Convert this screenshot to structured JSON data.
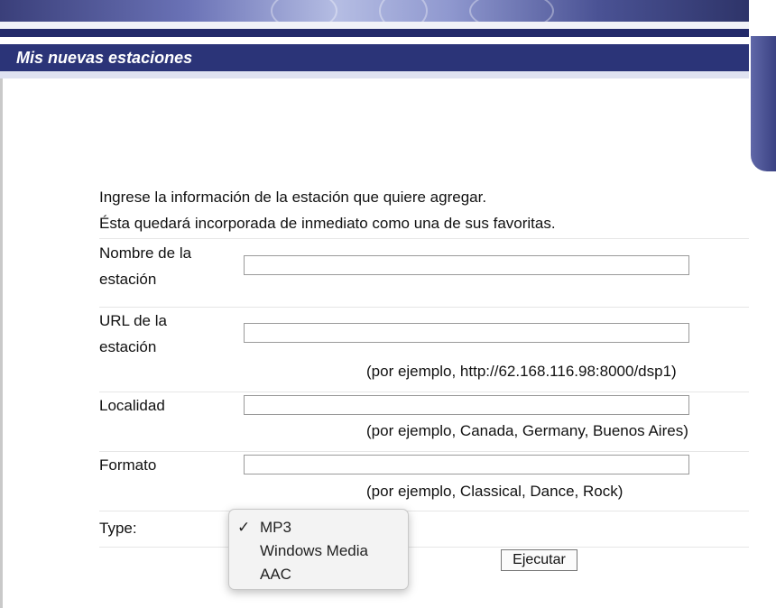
{
  "header": {
    "title": "Mis nuevas estaciones"
  },
  "intro": {
    "line1": "Ingrese la información de la estación que quiere agregar.",
    "line2": "Ésta quedará incorporada de inmediato como una de sus favoritas."
  },
  "form": {
    "name": {
      "label_line1": "Nombre de la",
      "label_line2": "estación",
      "value": ""
    },
    "url": {
      "label_line1": "URL de la",
      "label_line2": "estación",
      "value": "",
      "hint": "(por ejemplo, http://62.168.116.98:8000/dsp1)"
    },
    "locality": {
      "label": "Localidad",
      "value": "",
      "hint": "(por ejemplo, Canada, Germany, Buenos Aires)"
    },
    "format": {
      "label": "Formato",
      "value": "",
      "hint": "(por ejemplo, Classical, Dance, Rock)"
    },
    "type": {
      "label": "Type:",
      "options": [
        "MP3",
        "Windows Media",
        "AAC"
      ],
      "selected": "MP3",
      "check_mark": "✓"
    },
    "submit_label": "Ejecutar"
  },
  "colors": {
    "header_bg": "#2b3478",
    "header_text": "#ffffff",
    "banner_rule": "#232a6a"
  }
}
